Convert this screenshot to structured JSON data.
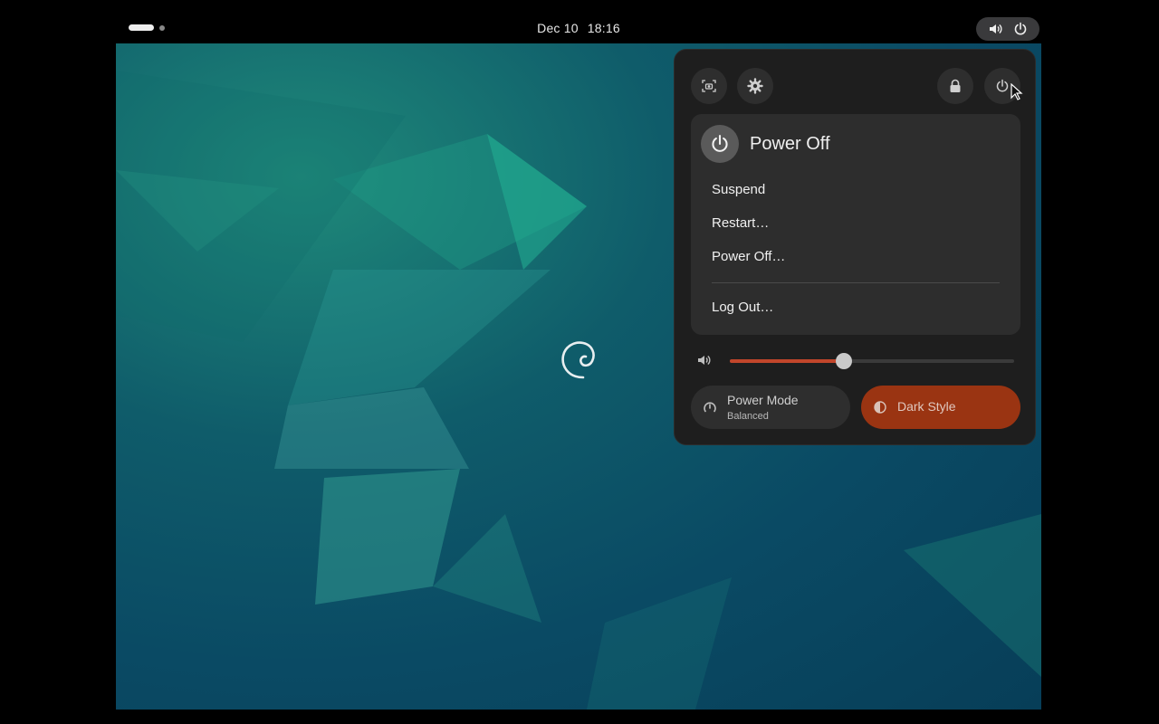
{
  "topbar": {
    "date": "Dec 10",
    "time": "18:16",
    "status_icons": [
      "volume-icon",
      "power-icon"
    ]
  },
  "quick_settings": {
    "top_buttons": [
      "screenshot-icon",
      "settings-icon",
      "lock-icon",
      "power-icon"
    ],
    "power_menu": {
      "title": "Power Off",
      "items": [
        "Suspend",
        "Restart…",
        "Power Off…"
      ],
      "logout": "Log Out…"
    },
    "volume": {
      "level": 0.4
    },
    "power_mode": {
      "label": "Power Mode",
      "value": "Balanced"
    },
    "dark_style": {
      "label": "Dark Style",
      "active": true
    }
  },
  "colors": {
    "accent": "#c2462b",
    "dark_style_active": "#9a3412",
    "menu_bg": "#1e1e1e"
  }
}
